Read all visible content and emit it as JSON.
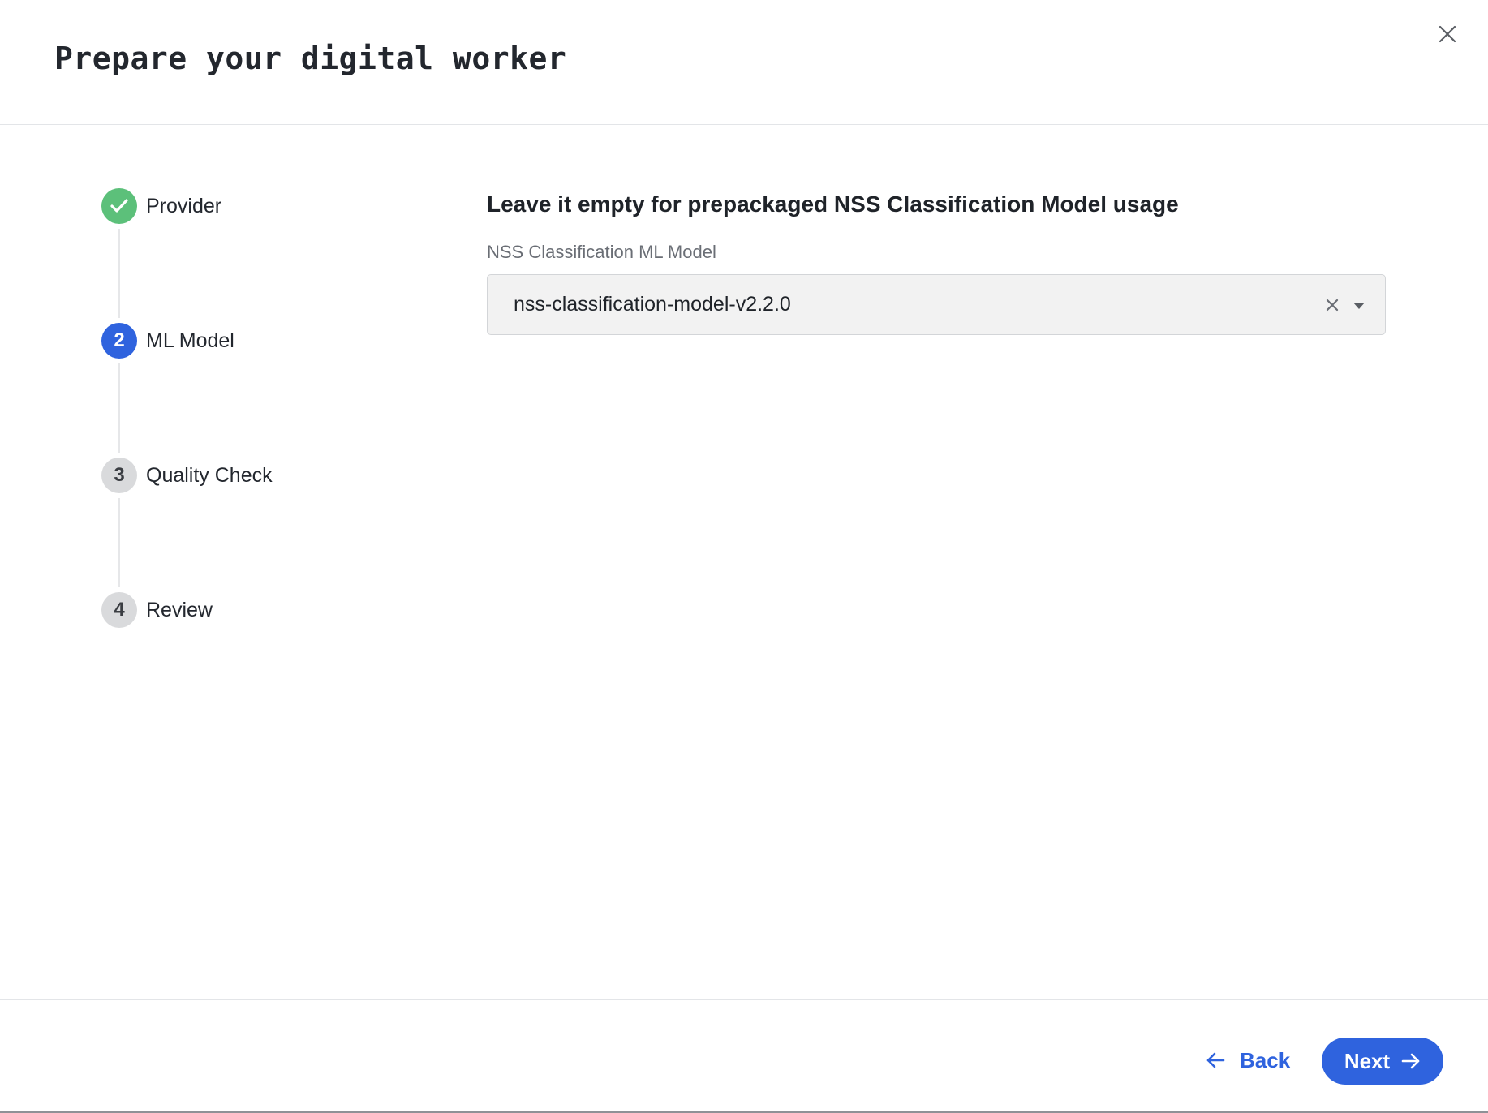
{
  "dialog": {
    "title": "Prepare your digital worker",
    "close_icon": "close-icon"
  },
  "stepper": {
    "steps": [
      {
        "number": "1",
        "label": "Provider",
        "state": "completed",
        "icon": "check-icon"
      },
      {
        "number": "2",
        "label": "ML Model",
        "state": "active"
      },
      {
        "number": "3",
        "label": "Quality Check",
        "state": "pending"
      },
      {
        "number": "4",
        "label": "Review",
        "state": "pending"
      }
    ]
  },
  "form": {
    "heading": "Leave it empty for prepackaged NSS Classification Model usage",
    "field_label": "NSS Classification ML Model",
    "selected_value": "nss-classification-model-v2.2.0",
    "clear_icon": "clear-icon",
    "dropdown_icon": "caret-down-icon"
  },
  "footer": {
    "back_label": "Back",
    "next_label": "Next",
    "back_icon": "arrow-left-icon",
    "next_icon": "arrow-right-icon"
  },
  "colors": {
    "primary": "#2f63de",
    "success": "#5cc07a",
    "pending": "#d9dadc",
    "field_background": "#f2f2f2"
  }
}
